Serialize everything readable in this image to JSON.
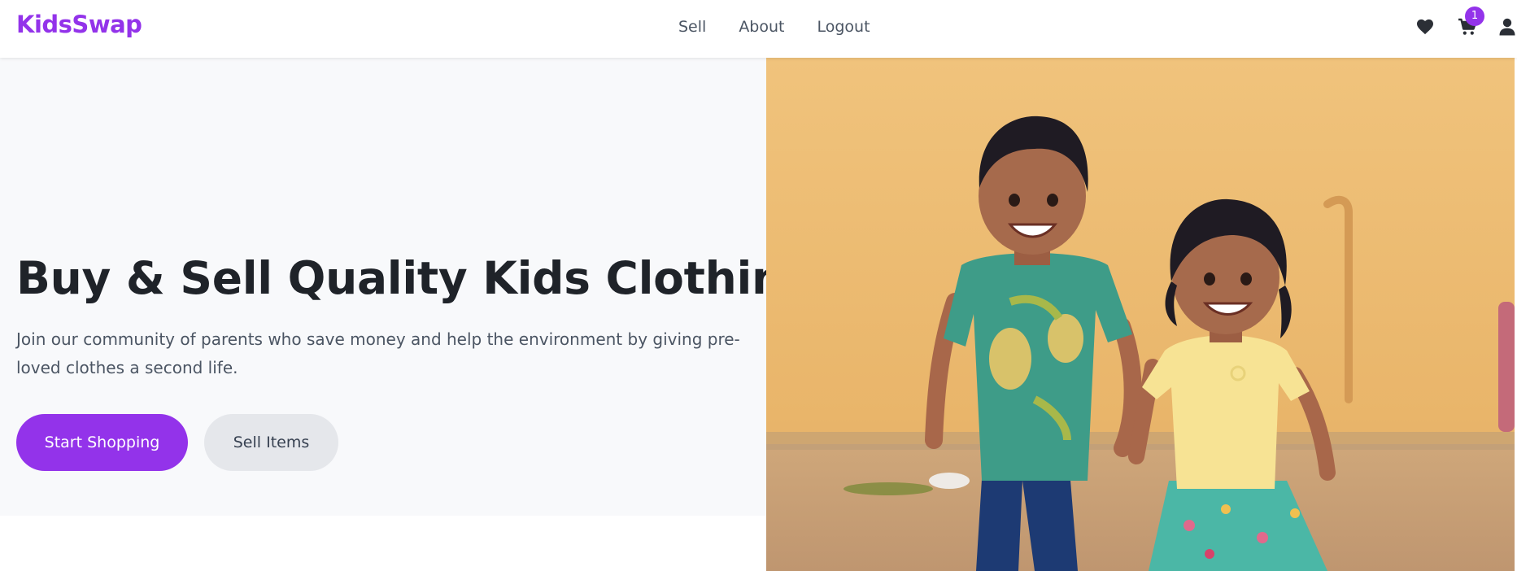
{
  "navbar": {
    "logo": "KidsSwap",
    "links": [
      "Sell",
      "About",
      "Logout"
    ],
    "icons": {
      "wishlist": "heart-icon",
      "cart": "cart-icon",
      "account": "user-icon"
    },
    "cart_count": "1"
  },
  "hero": {
    "title": "Buy & Sell Quality Kids Clothing",
    "subtitle": "Join our community of parents who save money and help the environment by giving pre-loved clothes a second life.",
    "primary_button": "Start Shopping",
    "secondary_button": "Sell Items"
  },
  "colors": {
    "brand": "#9333ea",
    "hero_bg": "#f8f9fb",
    "secondary_button_bg": "#e5e7eb",
    "text_dark": "#1f2329",
    "text_muted": "#4b5563"
  }
}
